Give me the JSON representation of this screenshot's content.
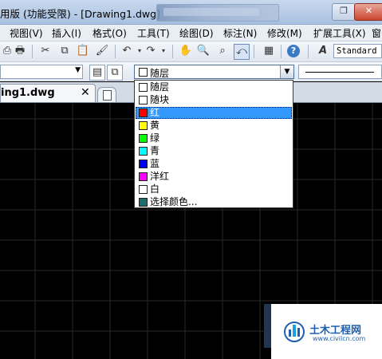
{
  "window": {
    "title": "用版 (功能受限) - [Drawing1.dwg]",
    "restore_glyph": "❐",
    "close_glyph": "✕"
  },
  "menu": [
    {
      "label": "视图(V)"
    },
    {
      "label": "插入(I)"
    },
    {
      "label": "格式(O)"
    },
    {
      "label": "工具(T)"
    },
    {
      "label": "绘图(D)"
    },
    {
      "label": "标注(N)"
    },
    {
      "label": "修改(M)"
    },
    {
      "label": "扩展工具(X)"
    },
    {
      "label": "窗"
    }
  ],
  "toolbar1": {
    "icons": [
      "plot-icon",
      "cut-icon",
      "copy-icon",
      "paste-icon",
      "match-properties-icon",
      "undo-icon",
      "redo-icon",
      "pan-icon",
      "zoom-realtime-icon",
      "zoom-window-icon",
      "zoom-previous-icon",
      "calculator-icon",
      "help-icon",
      "text-style-icon"
    ],
    "text_style": "Standard"
  },
  "toolbar2": {
    "layer_value": "",
    "color_value": "随层",
    "dropdown_glyph": "▼"
  },
  "document": {
    "tab_name": "ing1.dwg",
    "close_glyph": "✕"
  },
  "color_options": [
    {
      "label": "随层",
      "swatch": "#ffffff",
      "selected": false
    },
    {
      "label": "随块",
      "swatch": "#ffffff",
      "selected": false
    },
    {
      "label": "红",
      "swatch": "#ff0000",
      "selected": true
    },
    {
      "label": "黄",
      "swatch": "#ffff00",
      "selected": false
    },
    {
      "label": "绿",
      "swatch": "#00ff00",
      "selected": false
    },
    {
      "label": "青",
      "swatch": "#00ffff",
      "selected": false
    },
    {
      "label": "蓝",
      "swatch": "#0000ff",
      "selected": false
    },
    {
      "label": "洋红",
      "swatch": "#ff00ff",
      "selected": false
    },
    {
      "label": "白",
      "swatch": "#ffffff",
      "selected": false
    },
    {
      "label": "选择颜色...",
      "swatch": "#1a6e6e",
      "selected": false
    }
  ],
  "watermark": {
    "title": "土木工程网",
    "url": "www.civilcn.com"
  },
  "colors": {
    "canvas": "#000000",
    "grid": "#2a2a2a",
    "selection": "#3399ff"
  }
}
